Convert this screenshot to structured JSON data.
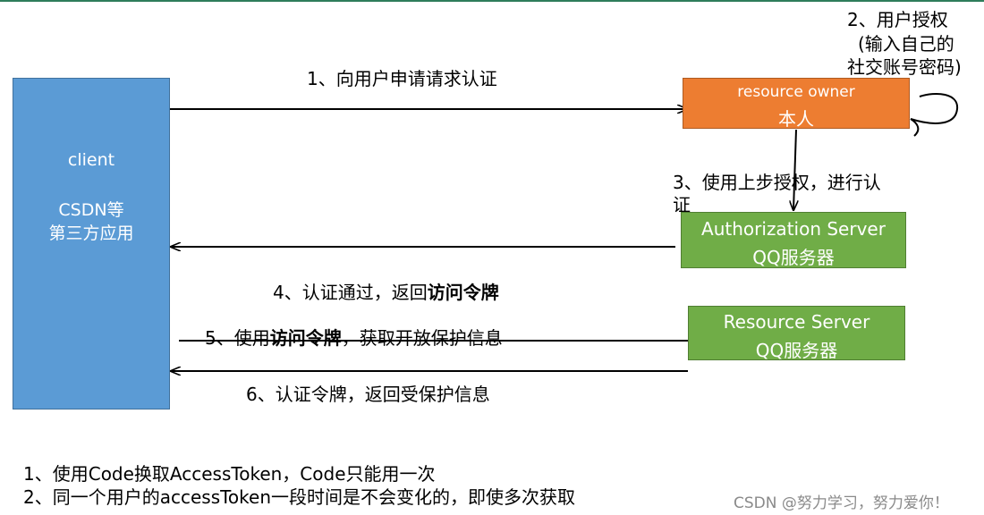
{
  "client": {
    "line1": "client",
    "line2": "CSDN等",
    "line3": "第三方应用"
  },
  "resource_owner": {
    "line1": "resource owner",
    "line2": "本人"
  },
  "authorization_server": {
    "line1": "Authorization Server",
    "line2": "QQ服务器"
  },
  "resource_server": {
    "line1": "Resource Server",
    "line2": "QQ服务器"
  },
  "steps": {
    "s1": "1、向用户申请请求认证",
    "s2_line1": "2、用户授权",
    "s2_line2": "(输入自己的",
    "s2_line3": "社交账号密码)",
    "s3_line1": "3、使用上步授权，进行认",
    "s3_line2": "证",
    "s4_prefix": "4、认证通过，返回",
    "s4_bold": "访问令牌",
    "s5_prefix": "5、使用",
    "s5_bold": "访问令牌",
    "s5_suffix": "，获取开放保护信息",
    "s6": "6、认证令牌，返回受保护信息"
  },
  "notes": {
    "n1": "1、使用Code换取AccessToken，Code只能用一次",
    "n2": "2、同一个用户的accessToken一段时间是不会变化的，即使多次获取"
  },
  "watermark": "CSDN @努力学习，努力爱你！",
  "colors": {
    "client": "#5b9bd5",
    "resource_owner": "#ed7d31",
    "server": "#70ad47",
    "top_line": "#2e7d5b"
  }
}
